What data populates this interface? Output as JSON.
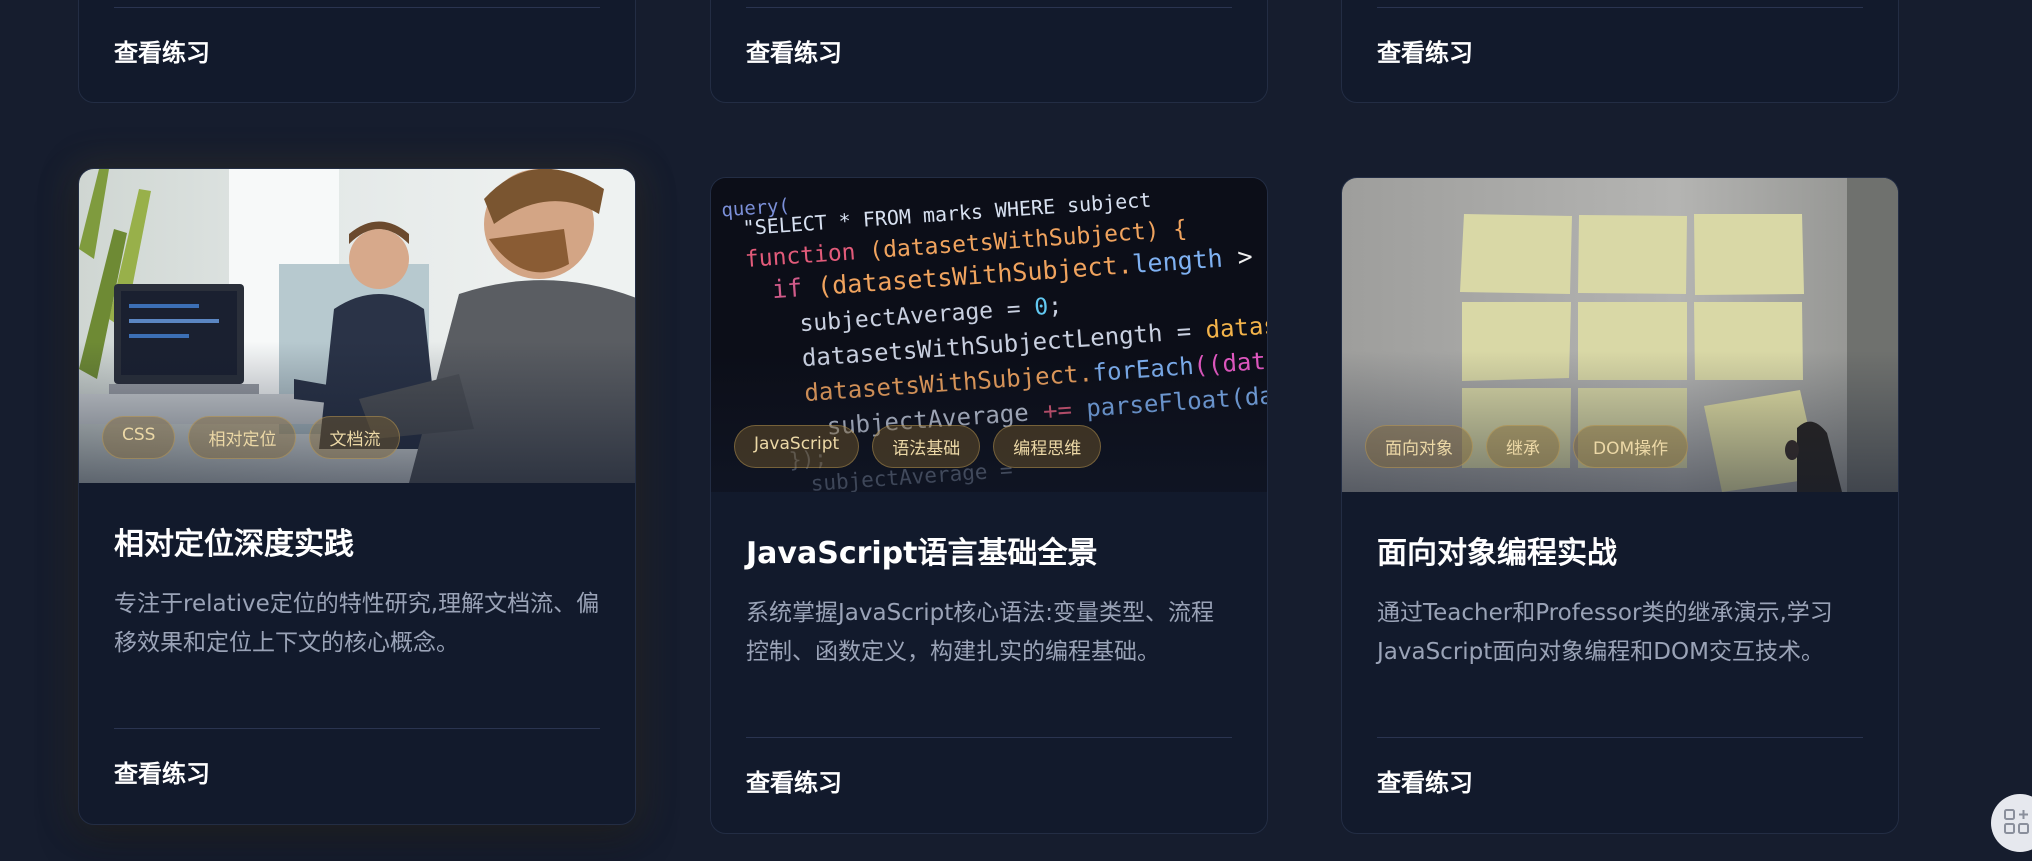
{
  "top_row": {
    "cards": [
      {
        "link_label": "查看练习"
      },
      {
        "link_label": "查看练习"
      },
      {
        "link_label": "查看练习"
      }
    ]
  },
  "bottom_row": {
    "cards": [
      {
        "image_icon": "people-coding-photo",
        "tags": [
          "CSS",
          "相对定位",
          "文档流"
        ],
        "title": "相对定位深度实践",
        "description": "专注于relative定位的特性研究,理解文档流、偏移效果和定位上下文的核心概念。",
        "link_label": "查看练习"
      },
      {
        "image_icon": "code-screen-photo",
        "tags": [
          "JavaScript",
          "语法基础",
          "编程思维"
        ],
        "title": "JavaScript语言基础全景",
        "description": "系统掌握JavaScript核心语法:变量类型、流程控制、函数定义，构建扎实的编程基础。",
        "link_label": "查看练习"
      },
      {
        "image_icon": "sticky-notes-photo",
        "tags": [
          "面向对象",
          "继承",
          "DOM操作"
        ],
        "title": "面向对象编程实战",
        "description": "通过Teacher和Professor类的继承演示,学习JavaScript面向对象编程和DOM交互技术。",
        "link_label": "查看练习"
      }
    ]
  },
  "fab": {
    "icon": "apps-grid-icon"
  },
  "colors": {
    "background": "#161d2e",
    "card": "#121a2c",
    "tag_text": "#ecd8a6",
    "description": "#9aa3b7"
  }
}
